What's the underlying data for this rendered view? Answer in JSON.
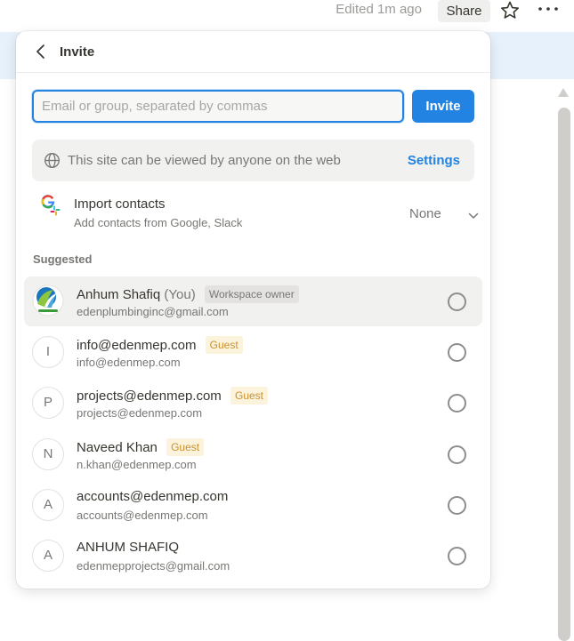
{
  "topbar": {
    "edited": "Edited 1m ago",
    "share_label": "Share",
    "star_icon": "star-icon",
    "more_icon": "more-icon"
  },
  "popover": {
    "title": "Invite",
    "back_icon": "chevron-left-icon",
    "email_placeholder": "Email or group, separated by commas",
    "email_value": "",
    "invite_label": "Invite",
    "web_access_text": "This site can be viewed by anyone on the web",
    "settings_label": "Settings",
    "import": {
      "title": "Import contacts",
      "subtitle": "Add contacts from Google, Slack",
      "selected": "None"
    },
    "suggested_label": "Suggested"
  },
  "people": [
    {
      "name": "Anhum Shafiq",
      "you": "(You)",
      "badge": "Workspace owner",
      "email": "edenplumbinginc@gmail.com",
      "avatar": "logo"
    },
    {
      "name": "info@edenmep.com",
      "badge": "Guest",
      "email": "info@edenmep.com",
      "avatar": "I"
    },
    {
      "name": "projects@edenmep.com",
      "badge": "Guest",
      "email": "projects@edenmep.com",
      "avatar": "P"
    },
    {
      "name": "Naveed Khan",
      "badge": "Guest",
      "email": "n.khan@edenmep.com",
      "avatar": "N"
    },
    {
      "name": "accounts@edenmep.com",
      "email": "accounts@edenmep.com",
      "avatar": "A"
    },
    {
      "name": "ANHUM SHAFIQ",
      "email": "edenmepprojects@gmail.com",
      "avatar": "A"
    }
  ],
  "colors": {
    "accent": "#2383e2",
    "guest_badge_bg": "#fbf3db",
    "guest_badge_text": "#cb912f",
    "owner_badge_bg": "#e3e2e0"
  }
}
